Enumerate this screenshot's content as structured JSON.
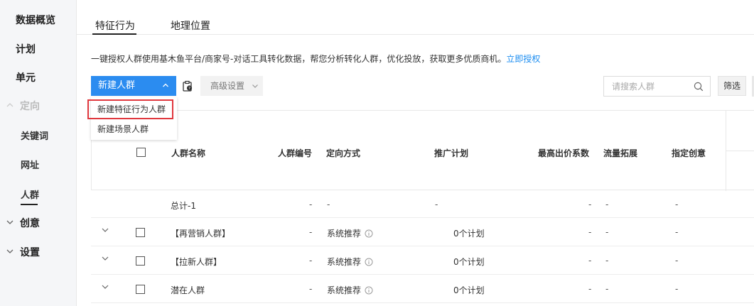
{
  "sidebar": {
    "items": [
      {
        "label": "数据概览"
      },
      {
        "label": "计划"
      },
      {
        "label": "单元"
      },
      {
        "label": "定向"
      },
      {
        "label": "关键词"
      },
      {
        "label": "网址"
      },
      {
        "label": "人群"
      },
      {
        "label": "创意"
      },
      {
        "label": "设置"
      }
    ]
  },
  "tabs": [
    {
      "label": "特征行为"
    },
    {
      "label": "地理位置"
    }
  ],
  "info": {
    "text": "一键授权人群使用基木鱼平台/商家号-对话工具转化数据，帮您分析转化人群，优化投放，获取更多优质商机。",
    "link": "立即授权"
  },
  "toolbar": {
    "new_label": "新建人群",
    "advanced_label": "高级设置",
    "search_placeholder": "请搜索人群",
    "filter_label": "筛选"
  },
  "dropdown": {
    "items": [
      {
        "label": "新建特征行为人群"
      },
      {
        "label": "新建场景人群"
      }
    ]
  },
  "table": {
    "headers": {
      "name": "人群名称",
      "id": "人群编号",
      "method": "定向方式",
      "plan": "推广计划",
      "bid": "最高出价系数",
      "expand": "流量拓展",
      "creative": "指定创意"
    },
    "total": {
      "name": "总计-1",
      "id": "-",
      "method": "-",
      "plan": "-",
      "bid": "-",
      "expand": "-",
      "creative": "-"
    },
    "rows": [
      {
        "name": "【再营销人群】",
        "id": "-",
        "method": "系统推荐",
        "plan": "0个计划",
        "bid": "-",
        "expand": "-",
        "creative": "-"
      },
      {
        "name": "【拉新人群】",
        "id": "-",
        "method": "系统推荐",
        "plan": "0个计划",
        "bid": "-",
        "expand": "-",
        "creative": "-"
      },
      {
        "name": "潜在人群",
        "id": "-",
        "method": "系统推荐",
        "plan": "0个计划",
        "bid": "-",
        "expand": "-",
        "creative": "-"
      }
    ]
  },
  "colors": {
    "primary": "#2b8cf0",
    "highlight": "#e0383e",
    "link": "#1a8cf0"
  }
}
